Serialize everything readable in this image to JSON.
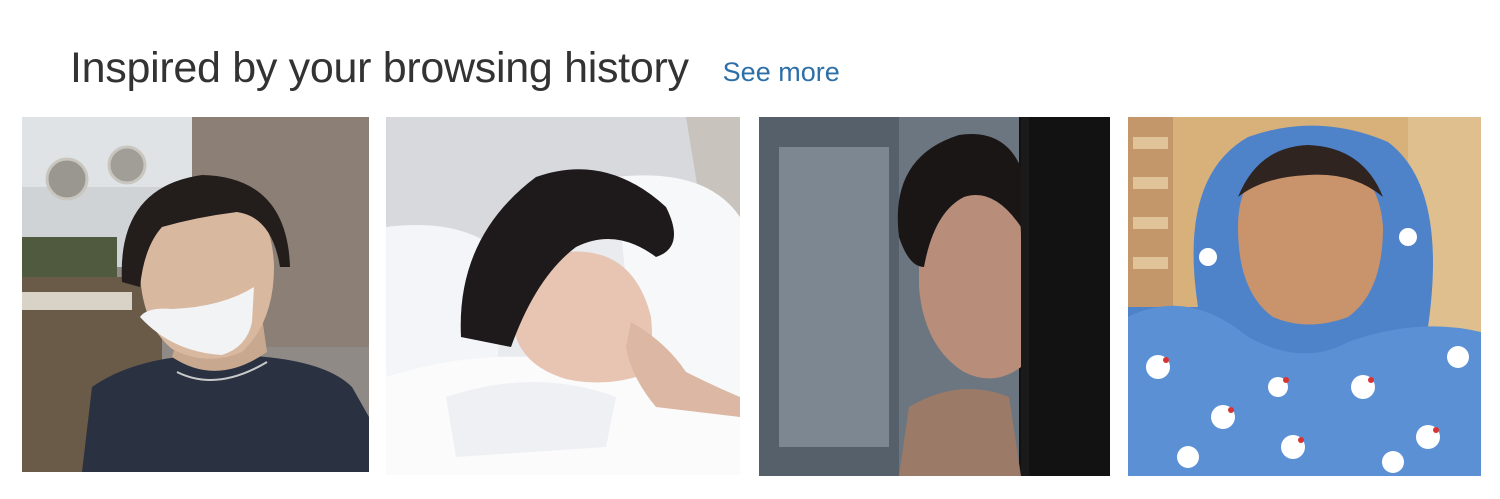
{
  "section": {
    "title": "Inspired by your browsing history",
    "see_more_label": "See more"
  },
  "products": [
    {
      "image": "photo-man-dark-hair-face-mask-navy-tee"
    },
    {
      "image": "photo-man-sleeping-white-pillow"
    },
    {
      "image": "photo-man-dark-hair-half-shadow"
    },
    {
      "image": "photo-man-blue-character-print-hoodie"
    }
  ],
  "colors": {
    "title": "#333333",
    "link": "#2d70a8",
    "background": "#ffffff"
  }
}
